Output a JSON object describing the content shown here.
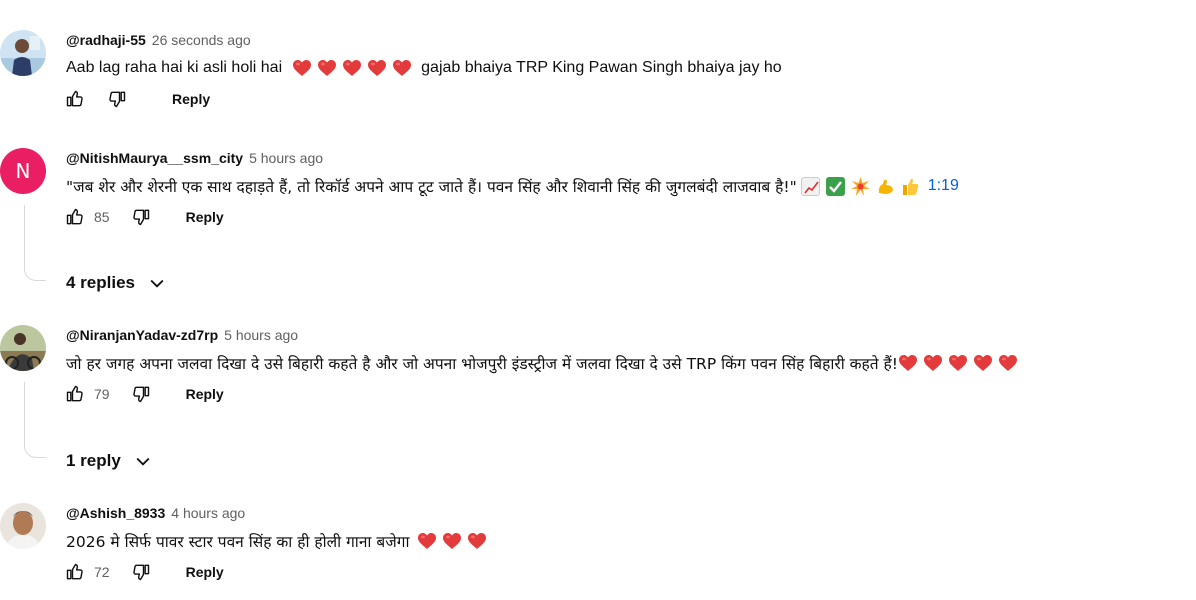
{
  "colors": {
    "author": "#0f0f0f",
    "meta": "#606060",
    "link": "#065fd4",
    "avatar_n_bg": "#e91e63",
    "heart": "#e33b3b"
  },
  "icons": {
    "like": "thumbs-up-outline-icon",
    "dislike": "thumbs-down-outline-icon",
    "heart": "red-heart-emoji-icon",
    "chevron": "chevron-down-icon"
  },
  "comments": [
    {
      "author": "@radhaji-55",
      "time": "26 seconds ago",
      "text": "Aab lag raha hai ki asli holi hai",
      "hearts": 5,
      "text2": "gajab bhaiya TRP King Pawan Singh bhaiya jay ho",
      "likes": "",
      "reply_label": "Reply"
    },
    {
      "author": "@NitishMaurya__ssm_city",
      "avatar_letter": "N",
      "time": "5 hours ago",
      "text": "\"जब शेर और शेरनी एक साथ दहाड़ते हैं, तो रिकॉर्ड अपने आप टूट जाते हैं। पवन सिंह और शिवानी सिंह की जुगलबंदी लाजवाब है!\"",
      "emojis": [
        "chart-increasing-emoji-icon",
        "check-mark-button-emoji-icon",
        "collision-emoji-icon",
        "flexed-biceps-emoji-icon",
        "thumbs-up-emoji-icon"
      ],
      "timestamp_link": "1:19",
      "likes": "85",
      "reply_label": "Reply",
      "replies_label": "4 replies"
    },
    {
      "author": "@NiranjanYadav-zd7rp",
      "time": "5 hours ago",
      "text": "जो हर जगह अपना जलवा दिखा दे उसे बिहारी कहते है और जो अपना भोजपुरी इंडस्ट्रीज में जलवा दिखा दे उसे TRP किंग पवन सिंह बिहारी कहते हैं!",
      "hearts": 5,
      "likes": "79",
      "reply_label": "Reply",
      "replies_label": "1 reply"
    },
    {
      "author": "@Ashish_8933",
      "time": "4 hours ago",
      "text": "2026 मे सिर्फ पावर स्टार पवन सिंह का ही होली गाना बजेगा",
      "hearts": 3,
      "likes": "72",
      "reply_label": "Reply"
    }
  ]
}
